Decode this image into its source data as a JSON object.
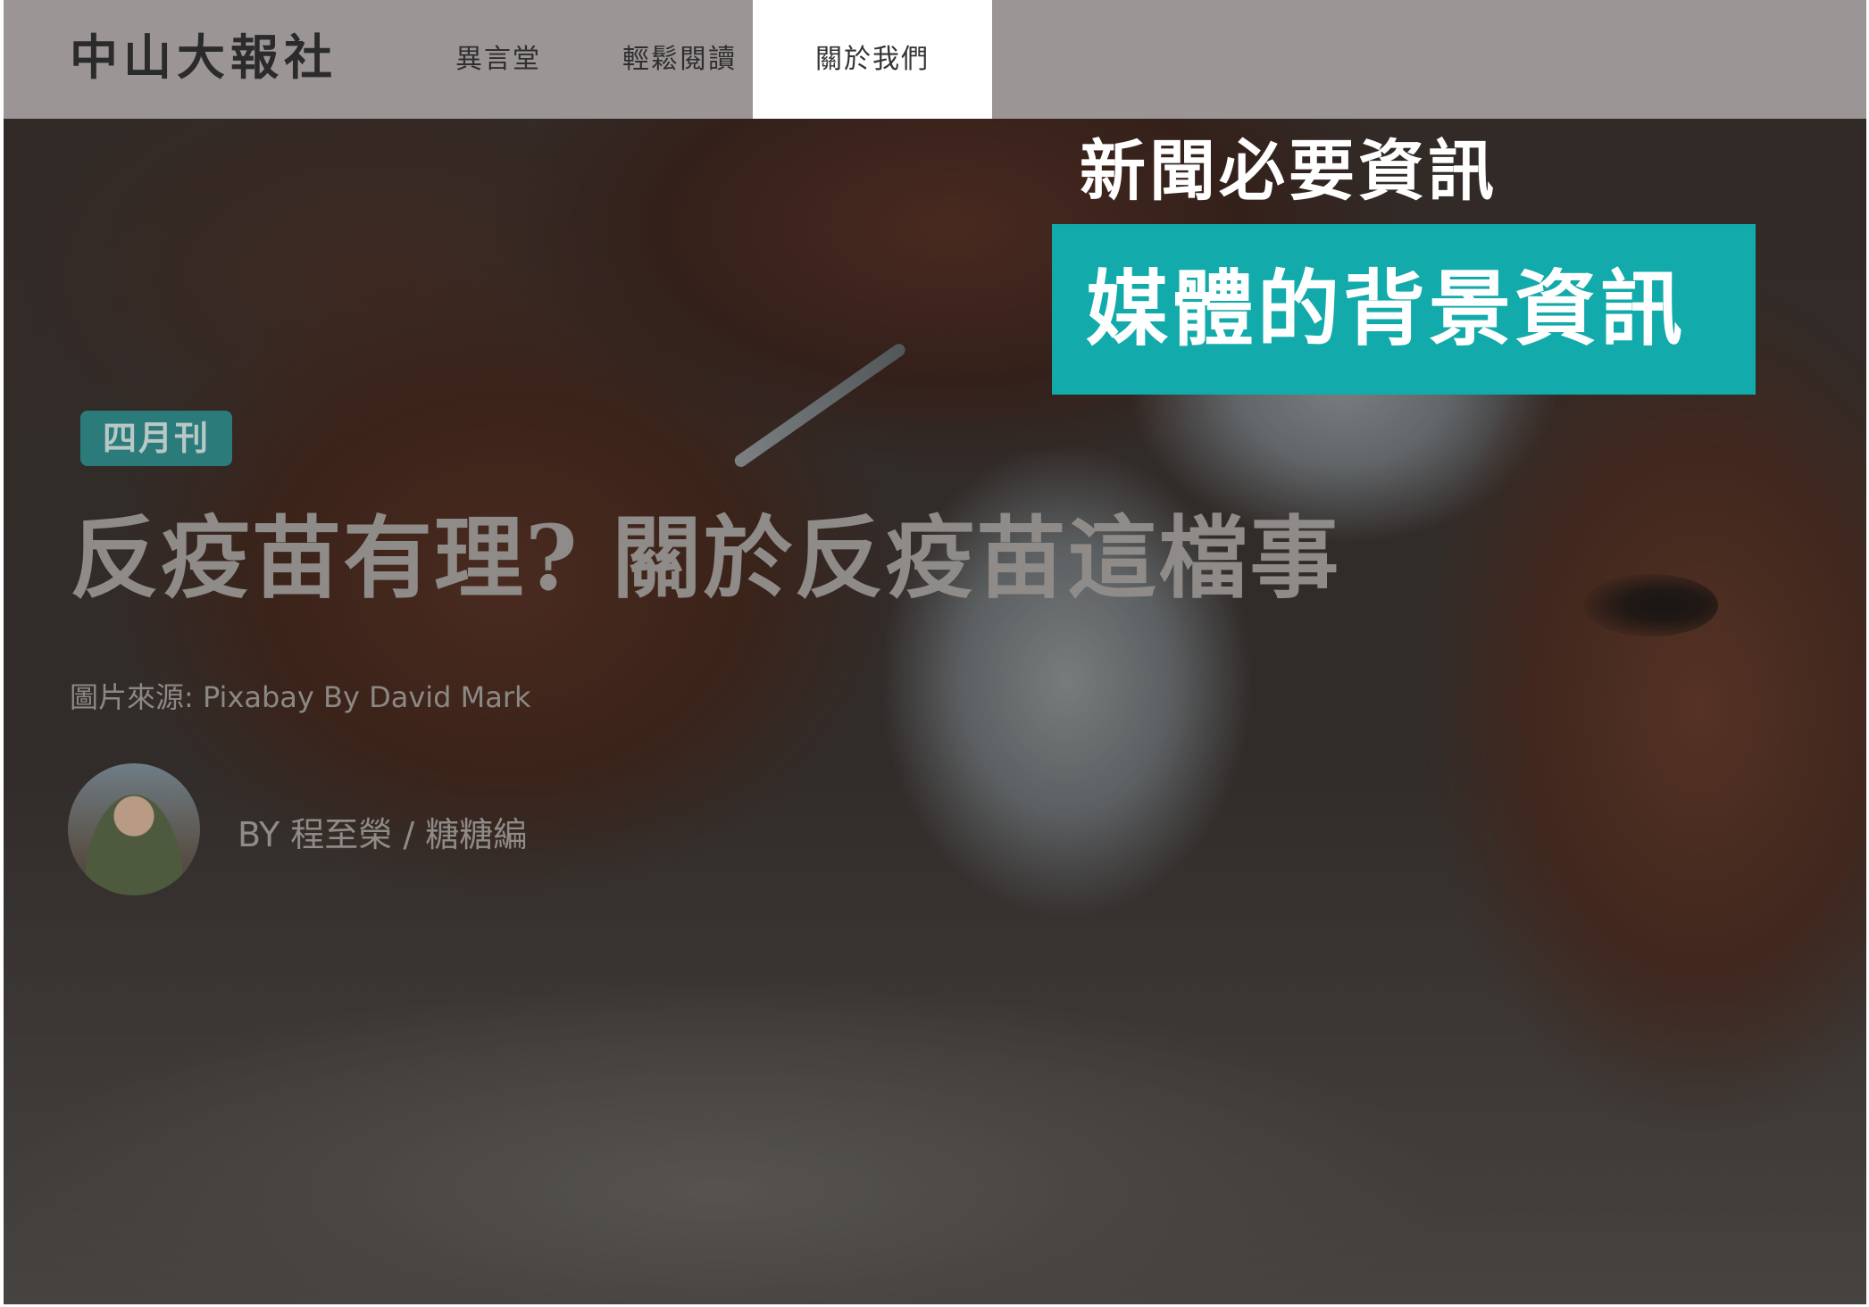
{
  "brand": "中山大報社",
  "nav": {
    "items": [
      {
        "label": "異言堂",
        "active": false
      },
      {
        "label": "輕鬆閱讀",
        "active": false
      },
      {
        "label": "關於我們",
        "active": true
      }
    ]
  },
  "annotation": {
    "title": "新聞必要資訊",
    "highlight": "媒體的背景資訊",
    "highlight_color": "#12aaaa"
  },
  "article": {
    "issue_badge": "四月刊",
    "title": "反疫苗有理? 關於反疫苗這檔事",
    "image_credit": "圖片來源: Pixabay By David Mark",
    "byline_prefix": "BY",
    "author": "程至榮 / 糖糖編"
  },
  "colors": {
    "nav_bg": "#9b9695",
    "nav_active_bg": "#ffffff",
    "badge_bg": "#2b7b7a"
  }
}
